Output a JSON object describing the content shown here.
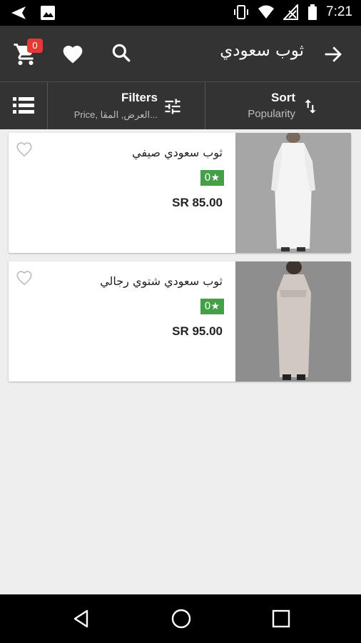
{
  "status_bar": {
    "time": "7:21",
    "icons": [
      "send-icon",
      "image-icon",
      "vibrate-icon",
      "wifi-icon",
      "no-signal-icon",
      "battery-icon"
    ]
  },
  "toolbar": {
    "title": "ثوب سعودي",
    "cart_count": "0",
    "icons": [
      "arrow-forward-icon",
      "search-icon",
      "heart-icon",
      "cart-icon"
    ]
  },
  "filter_bar": {
    "filters_label": "Filters",
    "filters_sub": "Price, العرض, المقا...",
    "sort_label": "Sort",
    "sort_sub": "Popularity",
    "icons": [
      "list-view-icon",
      "sliders-icon",
      "sort-arrows-icon"
    ]
  },
  "products": [
    {
      "title": "ثوب سعودي صيفي",
      "rating": "0★",
      "price": "SR 85.00",
      "image_tone": "white"
    },
    {
      "title": "ثوب سعودي شتوي رجالي",
      "rating": "0★",
      "price": "SR 95.00",
      "image_tone": "grey"
    }
  ],
  "colors": {
    "toolbar": "#333333",
    "background": "#eeeeee",
    "rating_green": "#43a047",
    "badge_red": "#e53935"
  }
}
